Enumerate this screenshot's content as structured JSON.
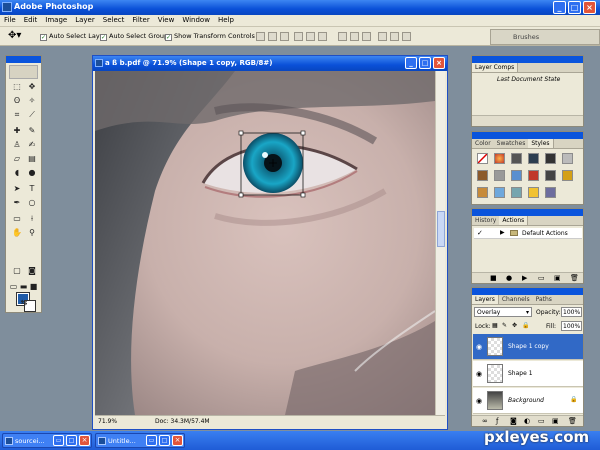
{
  "app": {
    "title": "Adobe Photoshop"
  },
  "menu": [
    "File",
    "Edit",
    "Image",
    "Layer",
    "Select",
    "Filter",
    "View",
    "Window",
    "Help"
  ],
  "options": {
    "auto_select_layer": "Auto Select Layer",
    "auto_select_groups": "Auto Select Groups",
    "show_transform": "Show Transform Controls"
  },
  "brushes_tab": "Brushes",
  "document": {
    "title": "a ß b.pdf @ 71.9% (Shape 1 copy, RGB/8#)",
    "zoom": "71.9%",
    "doc_info": "Doc: 34.3M/57.4M"
  },
  "layer_comps": {
    "tab": "Layer Comps",
    "item": "Last Document State"
  },
  "swatches_panel": {
    "tabs": [
      "Color",
      "Swatches",
      "Styles"
    ],
    "active": "Styles"
  },
  "actions_panel": {
    "tabs": [
      "History",
      "Actions"
    ],
    "active": "Actions",
    "item": "Default Actions"
  },
  "layers_panel": {
    "tabs": [
      "Layers",
      "Channels",
      "Paths"
    ],
    "blend_mode": "Overlay",
    "opacity_label": "Opacity:",
    "opacity": "100%",
    "lock_label": "Lock:",
    "fill_label": "Fill:",
    "fill": "100%",
    "layers": [
      {
        "name": "Shape 1 copy",
        "selected": true
      },
      {
        "name": "Shape 1",
        "selected": false
      },
      {
        "name": "Background",
        "selected": false
      }
    ]
  },
  "taskbar": [
    {
      "label": "sourcei..."
    },
    {
      "label": "Untitle..."
    }
  ],
  "watermark": "pxleyes.com",
  "colors": {
    "accent": "#0a54dc",
    "foreground": "#1d5aa7",
    "background": "#ffffff",
    "iris": "#1aa7c6",
    "selection": "#3169c6"
  }
}
